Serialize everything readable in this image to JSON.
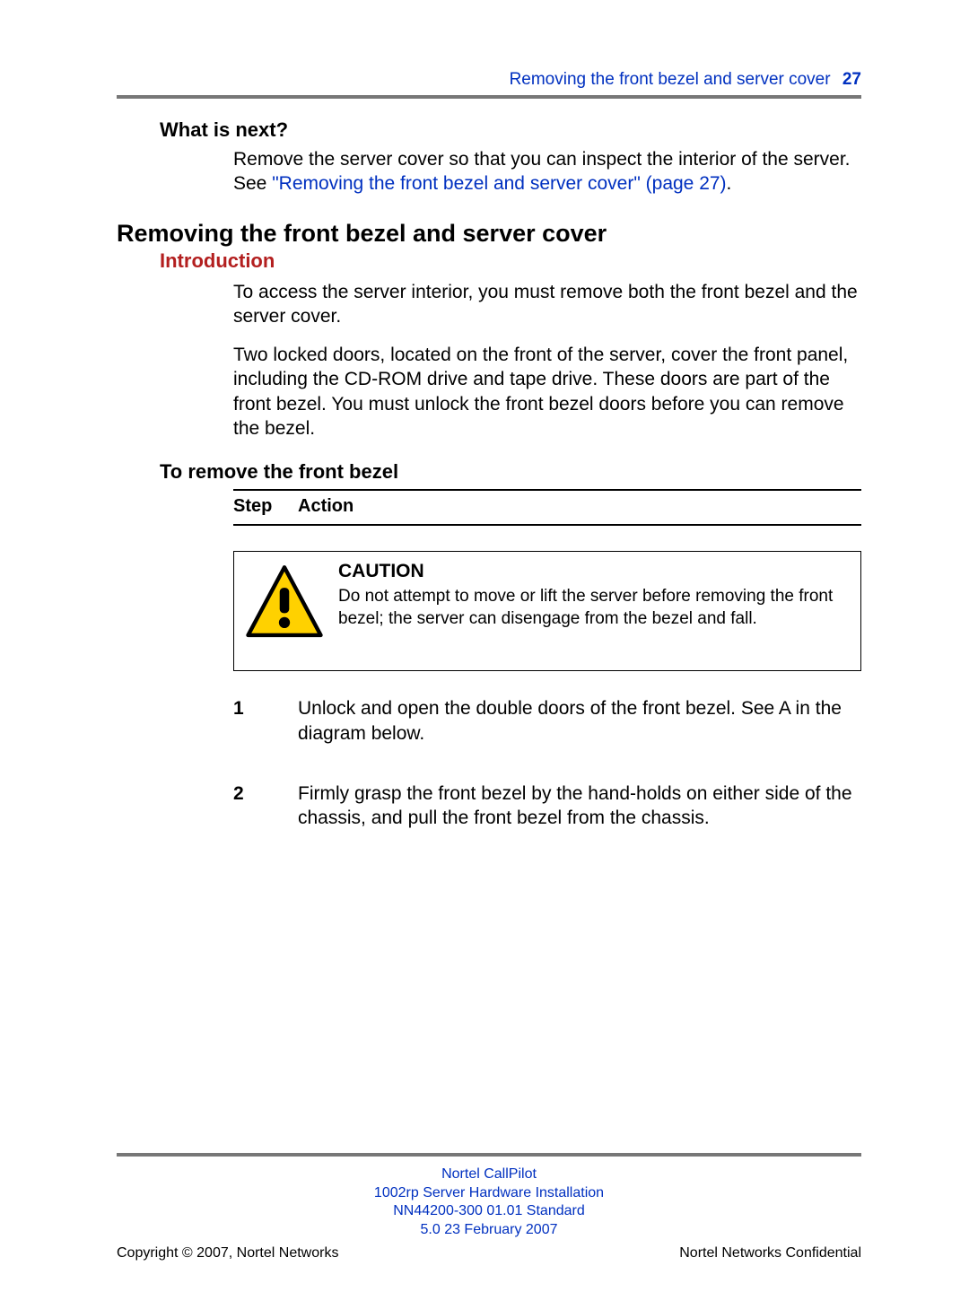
{
  "header": {
    "running_title": "Removing the front bezel and server cover",
    "page_number": "27"
  },
  "sections": {
    "what_next": {
      "heading": "What is next?",
      "body_plain1": "Remove the server cover so that you can inspect the interior of the server. See ",
      "link_text": "\"Removing the front bezel and server cover\" (page 27)",
      "body_plain2": "."
    },
    "main_heading": "Removing the front bezel and server cover",
    "intro": {
      "heading": "Introduction",
      "para1": "To access the server interior, you must remove both the front bezel and the server cover.",
      "para2": "Two locked doors, located on the front of the server, cover the front panel, including the CD-ROM drive and tape drive. These doors are part of the front bezel. You must unlock the front bezel doors before you can remove the bezel."
    },
    "procedure": {
      "heading": "To remove the front bezel",
      "step_label": "Step",
      "action_label": "Action",
      "caution": {
        "title": "CAUTION",
        "body": "Do not attempt to move or lift the server before removing the front bezel; the server can disengage from the bezel and fall."
      },
      "steps": [
        {
          "num": "1",
          "text": "Unlock and open the double doors of the front bezel. See A in the diagram below."
        },
        {
          "num": "2",
          "text": "Firmly grasp the front bezel by the hand-holds on either side of the chassis, and pull the front bezel from the chassis."
        }
      ]
    }
  },
  "footer": {
    "line1": "Nortel CallPilot",
    "line2": "1002rp Server Hardware Installation",
    "line3": "NN44200-300   01.01   Standard",
    "line4": "5.0   23 February 2007",
    "copyright": "Copyright © 2007, Nortel Networks",
    "confidential": "Nortel Networks Confidential"
  },
  "colors": {
    "link": "#0030c0",
    "subhead": "#b31f1f",
    "rule": "#777"
  }
}
